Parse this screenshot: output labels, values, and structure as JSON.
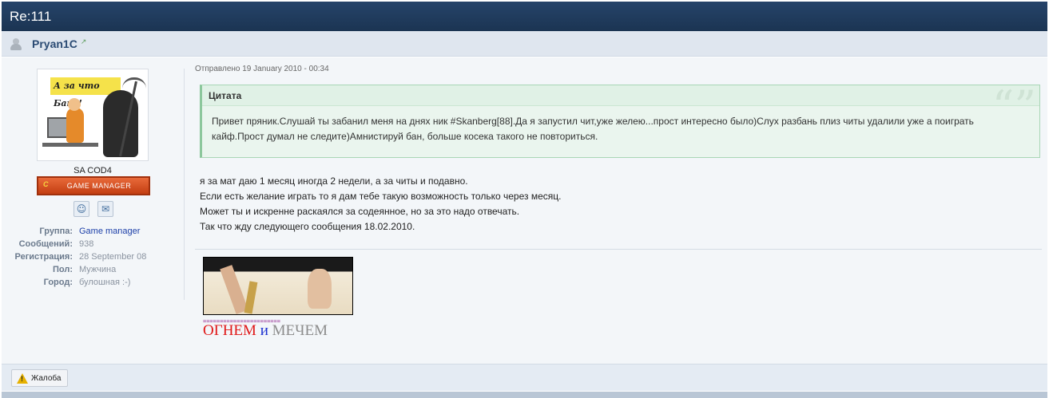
{
  "topic": {
    "title": "Re:111"
  },
  "author": {
    "name": "Pryan1C"
  },
  "sidebar": {
    "avatar_caption": "А за что Бан?!",
    "group_title": "SA COD4",
    "rank_badge": "GAME MANAGER",
    "rank_logo": "C",
    "profile": [
      {
        "label": "Группа:",
        "value": "Game manager"
      },
      {
        "label": "Сообщений:",
        "value": "938"
      },
      {
        "label": "Регистрация:",
        "value": "28 September 08"
      },
      {
        "label": "Пол:",
        "value": "Мужчина"
      },
      {
        "label": "Город:",
        "value": "булошная :-)"
      }
    ]
  },
  "post": {
    "date": "Отправлено 19 January 2010 - 00:34",
    "quote_header": "Цитата",
    "quote_lines": [
      "Привет пряник.Слушай ты забанил меня на днях ник #Skanberg[88].Да я запустил чит,уже желею...прост интересно было)Слух разбань плиз читы удалили уже а поиграть",
      "кайф.Прост думал не следите)Амнистируй бан, больше косека такого не повториться."
    ],
    "lines": [
      "я за мат даю 1 месяц иногда 2 недели, а за читы и подавно.",
      "Если есть желание играть то я дам тебе такую возможность только через месяц.",
      "Может ты и искренне раскаялся за содеянное, но за это надо отвечать.",
      "Так что жду следующего сообщения 18.02.2010."
    ]
  },
  "signature": {
    "divider": "=======================",
    "word1": "ОГНЕМ",
    "word2": "и",
    "word3": "МЕЧЕМ"
  },
  "footer": {
    "report_label": "Жалоба"
  },
  "colors": {
    "header": "#1f3a5c",
    "quote_bg": "#eaf5ee",
    "rank": "#d4501f",
    "sig_red": "#e01818",
    "sig_blue": "#1a2fd0"
  }
}
